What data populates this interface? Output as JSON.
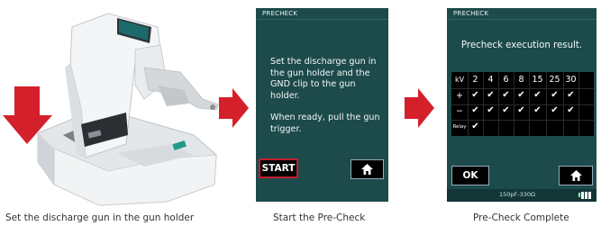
{
  "screen1": {
    "title": "PRECHECK",
    "instruction_1": "Set the discharge gun in the gun holder and the GND clip to the gun holder.",
    "instruction_2": "When ready, pull the gun trigger.",
    "start_label": "START"
  },
  "screen2": {
    "title": "PRECHECK",
    "result_text": "Precheck execution result.",
    "kv_label": "kV",
    "kv_values": [
      "2",
      "4",
      "6",
      "8",
      "15",
      "25",
      "30"
    ],
    "rows": [
      {
        "label": "+",
        "checks": [
          true,
          true,
          true,
          true,
          true,
          true,
          true
        ]
      },
      {
        "label": "−",
        "checks": [
          true,
          true,
          true,
          true,
          true,
          true,
          true
        ]
      },
      {
        "label": "Relay",
        "checks": [
          true
        ]
      }
    ],
    "ok_label": "OK",
    "status_text": "150pF-330Ω"
  },
  "captions": {
    "step1": "Set the discharge gun in the gun holder",
    "step2": "Start the Pre-Check",
    "step3": "Pre-Check Complete"
  },
  "colors": {
    "arrow": "#d4202a",
    "screen_bg": "#1d4a4b",
    "highlight": "#c0202e"
  }
}
